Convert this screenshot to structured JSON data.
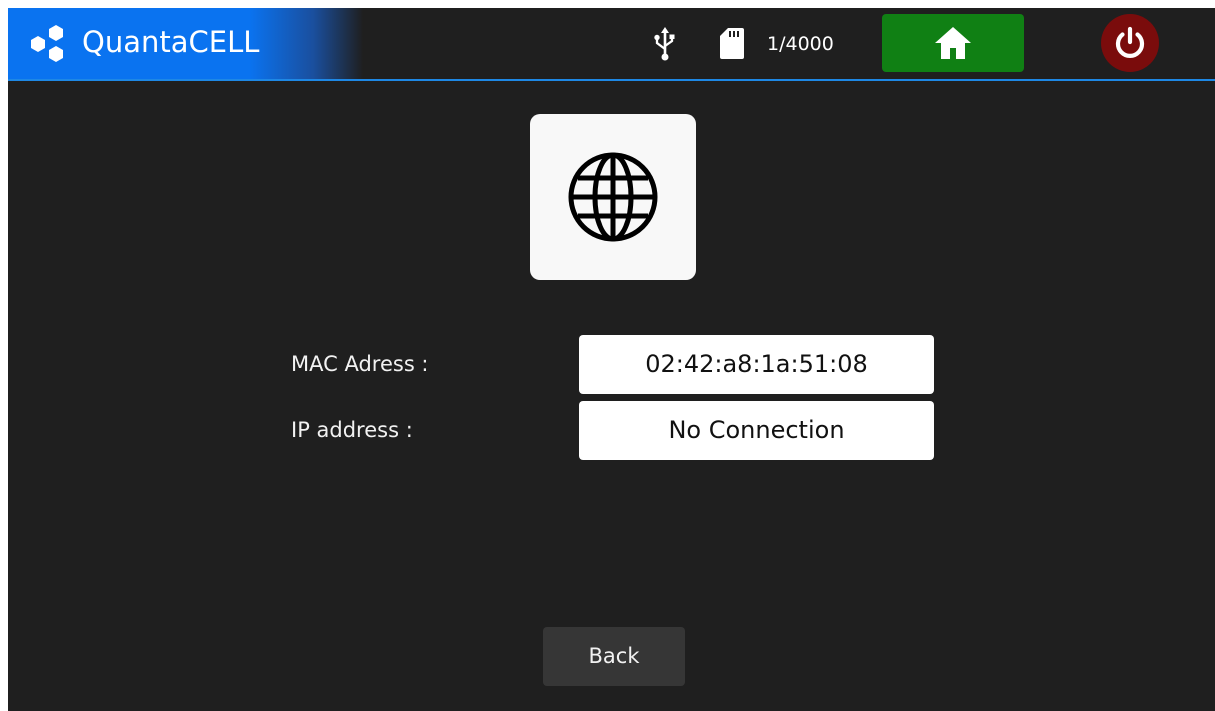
{
  "app": {
    "brand_name": "QuantaCELL"
  },
  "status_bar": {
    "usb_icon": "usb-icon",
    "sd_icon": "sd-card-icon",
    "counter": "1/4000",
    "home_icon": "home-icon",
    "power_icon": "power-icon"
  },
  "colors": {
    "brand_blue": "#0a73f0",
    "accent_line": "#1e88e5",
    "home_green": "#108014",
    "power_red": "#7a0c0c",
    "background": "#1f1f1f"
  },
  "main": {
    "network_icon": "globe-icon",
    "mac": {
      "label": "MAC Adress :",
      "value": "02:42:a8:1a:51:08"
    },
    "ip": {
      "label": "IP address :",
      "value": "No Connection"
    },
    "back_label": "Back"
  }
}
